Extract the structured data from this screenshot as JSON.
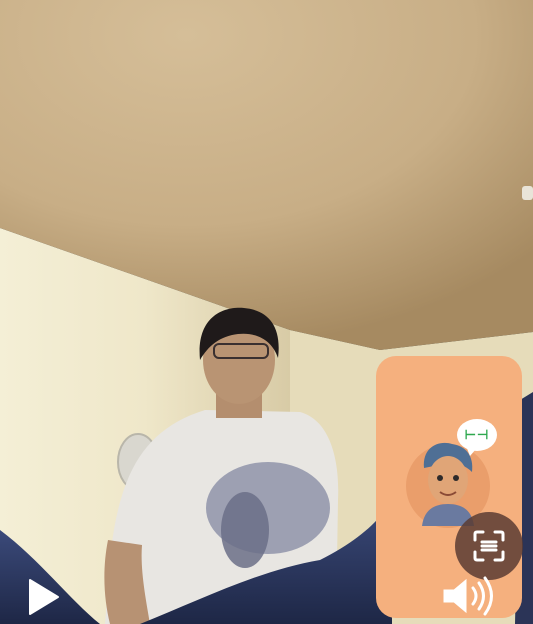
{
  "call": {
    "mode": "video-call",
    "remote_view": "person-in-room",
    "self_view": "avatar",
    "status_emoji": "⊢⊣"
  },
  "controls": {
    "play_icon": "play-icon",
    "speaker_icon": "speaker-icon",
    "scan_icon": "scan-icon"
  },
  "colors": {
    "pip_background": "#f5b07e",
    "ceiling": "#cdb58f",
    "wall": "#f1ead0"
  }
}
